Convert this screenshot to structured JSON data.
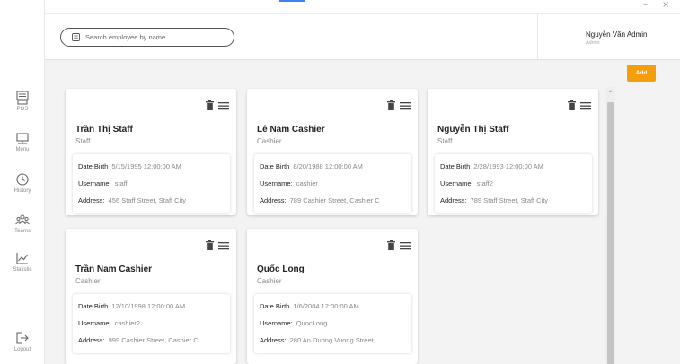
{
  "window": {
    "minimize": "–",
    "close": "×"
  },
  "sidebar": {
    "items": [
      {
        "label": "POS",
        "icon": "pos-icon"
      },
      {
        "label": "Menu",
        "icon": "menu-icon"
      },
      {
        "label": "History",
        "icon": "history-icon"
      },
      {
        "label": "Teams",
        "icon": "teams-icon"
      },
      {
        "label": "Statistic",
        "icon": "statistic-icon"
      },
      {
        "label": "Logout",
        "icon": "logout-icon"
      }
    ]
  },
  "search": {
    "placeholder": "Search employee by name",
    "value": ""
  },
  "user": {
    "name": "Nguyễn Văn Admin",
    "role": "Admin"
  },
  "add_label": "Add",
  "labels": {
    "date_birth": "Date Birth",
    "username": "Username:",
    "address": "Address:"
  },
  "employees": [
    {
      "name": "Trần Thị Staff",
      "role": "Staff",
      "date_birth": "5/15/1995 12:00:00 AM",
      "username": "staff",
      "address": "456 Staff Street, Staff City"
    },
    {
      "name": "Lê Nam Cashier",
      "role": "Cashier",
      "date_birth": "8/20/1988 12:00:00 AM",
      "username": "cashier",
      "address": "789 Cashier Street, Cashier C"
    },
    {
      "name": "Nguyễn Thị Staff",
      "role": "Staff",
      "date_birth": "2/28/1993 12:00:00 AM",
      "username": "staff2",
      "address": "789 Staff Street, Staff City"
    },
    {
      "name": "Trần Nam Cashier",
      "role": "Cashier",
      "date_birth": "12/10/1998 12:00:00 AM",
      "username": "cashier2",
      "address": "999 Cashier Street, Cashier C"
    },
    {
      "name": "Quốc Long",
      "role": "Cashier",
      "date_birth": "1/6/2004 12:00:00 AM",
      "username": "QuocLong",
      "address": "280 An Duong Vuong Street,"
    }
  ],
  "colors": {
    "accent": "#f59e0b",
    "tab_indicator": "#3b82f6",
    "background": "#f3f3f3"
  }
}
